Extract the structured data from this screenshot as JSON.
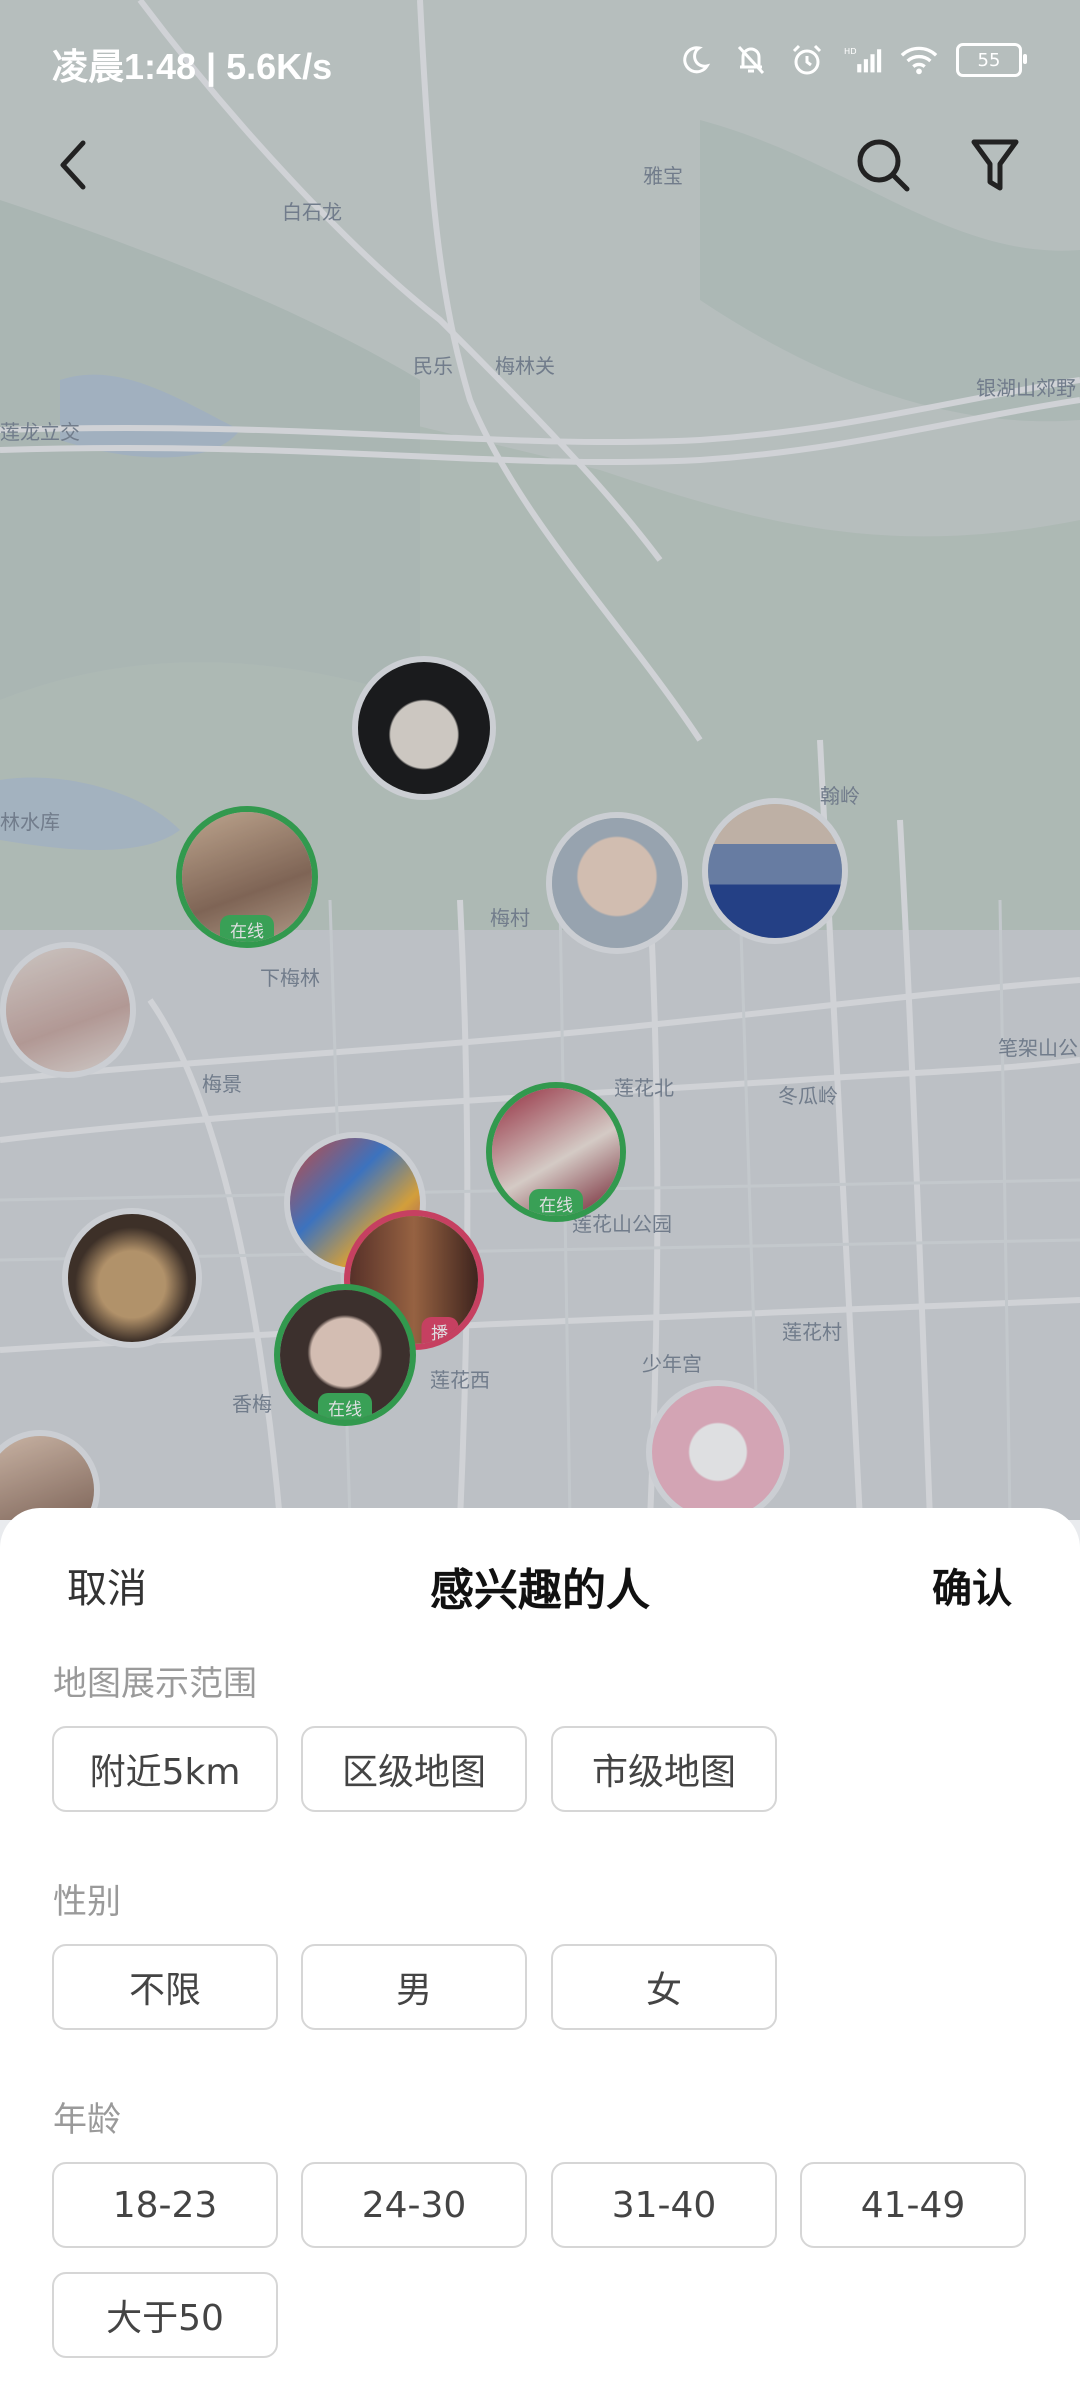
{
  "status_bar": {
    "time": "凌晨1:48 | 5.6K/s",
    "battery": "55",
    "icons": [
      "moon-icon",
      "bell-off-icon",
      "alarm-icon",
      "hd-signal-icon",
      "wifi-icon",
      "battery-icon"
    ]
  },
  "top_bar": {
    "icons": [
      "back-icon",
      "search-icon",
      "filter-icon"
    ]
  },
  "map": {
    "labels": [
      "白石龙",
      "雅宝",
      "民乐",
      "梅林关",
      "银湖山郊野",
      "莲龙立交",
      "林水库",
      "翰岭",
      "梅村",
      "下梅林",
      "笔架山公",
      "梅景",
      "莲花北",
      "冬瓜岭",
      "莲花山公园",
      "莲花村",
      "少年宫",
      "香梅",
      "莲花西"
    ],
    "avatar_badges": {
      "online": "在线",
      "live": "播"
    }
  },
  "sheet": {
    "cancel": "取消",
    "title": "感兴趣的人",
    "confirm": "确认",
    "sections": [
      {
        "label": "地图展示范围",
        "options": [
          "附近5km",
          "区级地图",
          "市级地图"
        ]
      },
      {
        "label": "性别",
        "options": [
          "不限",
          "男",
          "女"
        ]
      },
      {
        "label": "年龄",
        "options": [
          "18-23",
          "24-30",
          "31-40",
          "41-49",
          "大于50"
        ]
      }
    ]
  }
}
